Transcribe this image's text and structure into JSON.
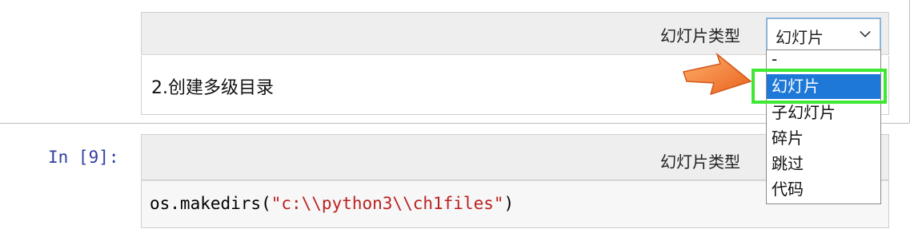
{
  "cell1": {
    "toolbar_label": "幻灯片类型",
    "select_value": "幻灯片",
    "rendered_text": "2.创建多级目录",
    "dropdown_options": [
      "-",
      "幻灯片",
      "子幻灯片",
      "碎片",
      "跳过",
      "代码"
    ],
    "selected_option": "幻灯片"
  },
  "cell2": {
    "prompt": "In [9]:",
    "toolbar_label": "幻灯片类型",
    "code_prefix": "os.makedirs(",
    "code_string": "\"c:\\\\python3\\\\ch1files\"",
    "code_suffix": ")"
  },
  "colors": {
    "highlight": "#3ee833",
    "selected_option_bg": "#1e78d7",
    "arrow": "#f07c2a",
    "prompt": "#303f9f",
    "string": "#ba2121"
  }
}
